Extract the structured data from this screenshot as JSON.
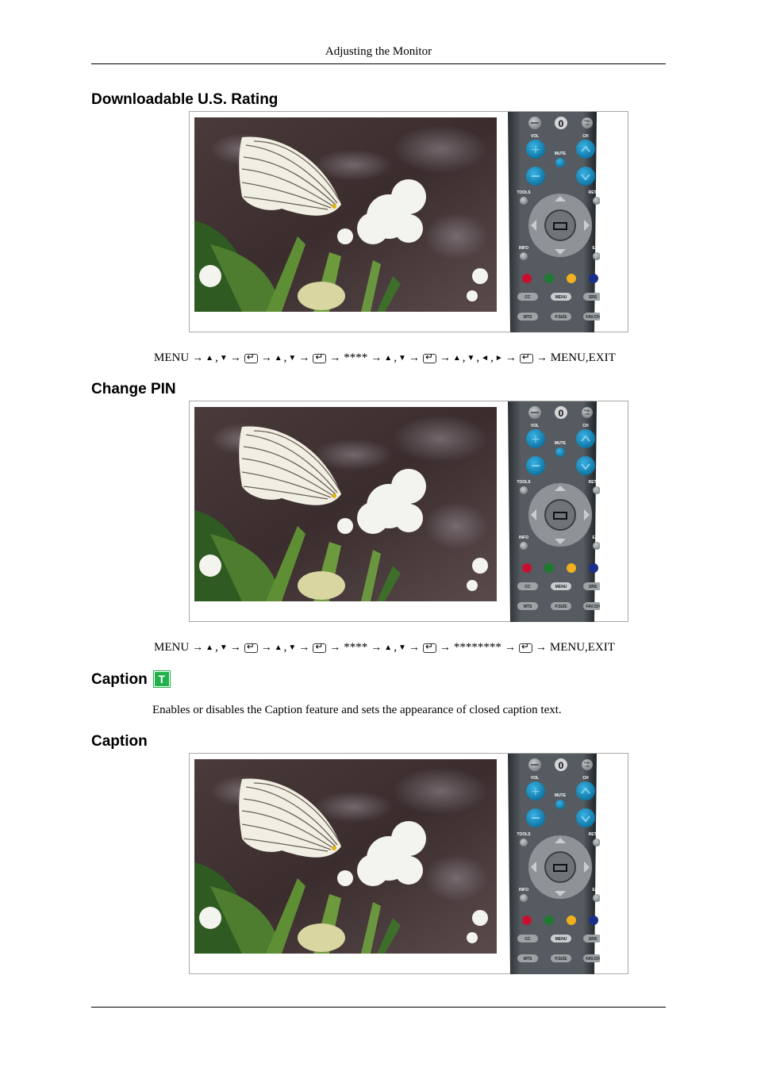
{
  "page": {
    "running_header": "Adjusting the Monitor"
  },
  "sections": [
    {
      "title": "Downloadable U.S. Rating",
      "nav_sequence": [
        "MENU",
        "→",
        "▲",
        ",",
        "▼",
        "→",
        "[enter]",
        "→",
        "▲",
        ",",
        "▼",
        "→",
        "[enter]",
        "→",
        "****",
        "→",
        "▲",
        ",",
        "▼",
        "→",
        "[enter]",
        "→",
        "▲",
        ",",
        "▼",
        ",",
        "◄",
        ",",
        "►",
        "→",
        "[enter]",
        "→",
        "MENU,EXIT"
      ]
    },
    {
      "title": "Change PIN",
      "nav_sequence": [
        "MENU",
        "→",
        "▲",
        ",",
        "▼",
        "→",
        "[enter]",
        "→",
        "▲",
        ",",
        "▼",
        "→",
        "[enter]",
        "→",
        "****",
        "→",
        "▲",
        ",",
        "▼",
        "→",
        "[enter]",
        "→",
        "********",
        "→",
        "[enter]",
        "→",
        "MENU,EXIT"
      ]
    },
    {
      "title": "Caption",
      "badge": "T",
      "description": "Enables or disables the Caption feature and sets the appearance of closed caption text."
    },
    {
      "title": "Caption"
    }
  ],
  "figure": {
    "photo_subject": "butterfly-on-white-flowers",
    "remote": {
      "top_buttons": [
        "—",
        "0",
        "PRE-CH"
      ],
      "vol_label": "VOL",
      "ch_label": "CH",
      "mute_label": "MUTE",
      "tools_label": "TOOLS",
      "return_label": "RETURN",
      "info_label": "INFO",
      "exit_label": "EXIT",
      "color_buttons": [
        "#c8102e",
        "#1e7a2e",
        "#f2b01e",
        "#1a2f8a"
      ],
      "row1_buttons": [
        "CC",
        "MENU",
        "SRS"
      ],
      "row2_buttons": [
        "MTS",
        "P.SIZE",
        "FAV.CH"
      ]
    }
  }
}
